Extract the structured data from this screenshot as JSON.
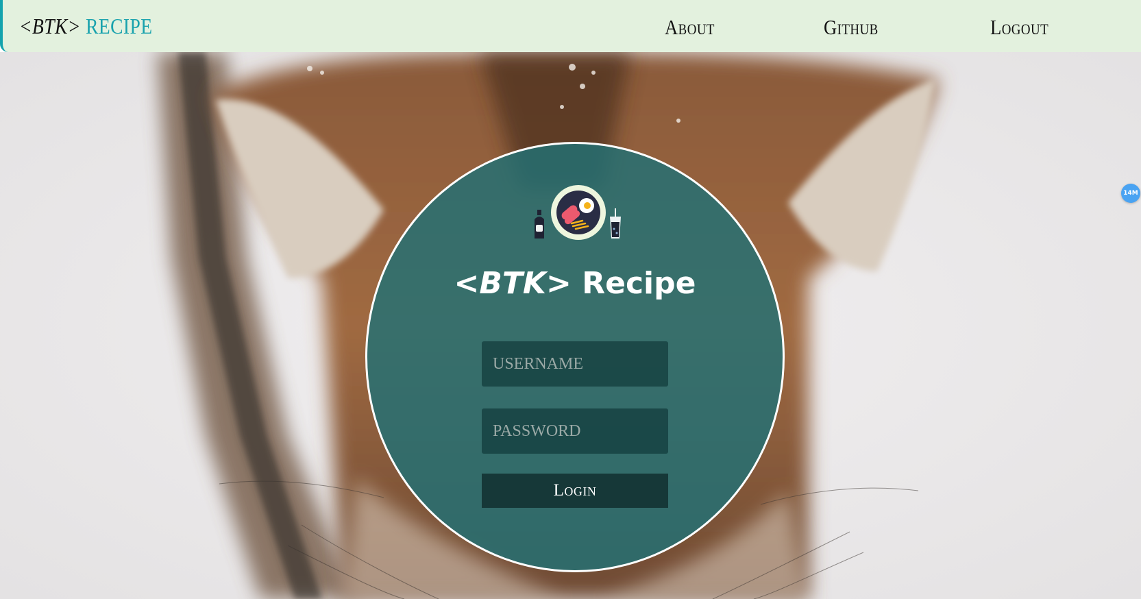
{
  "navbar": {
    "brand_tag": "<BTK>",
    "brand_word": "RECIPE",
    "links": [
      "About",
      "Github",
      "Logout"
    ]
  },
  "login": {
    "title_tag": "<BTK>",
    "title_word": "Recipe",
    "username_placeholder": "USERNAME",
    "password_placeholder": "PASSWORD",
    "button_label": "Login"
  },
  "side_badge": {
    "label": "14M"
  },
  "colors": {
    "navbar_bg": "#e3f1de",
    "brand_accent": "#18a2ad",
    "circle_overlay": "#217075",
    "button_bg": "#163838",
    "badge_bg": "#4aa3f2"
  },
  "icons": {
    "logo": "food-plate-icon",
    "bottle": "sauce-bottle-icon",
    "drink": "drink-cup-icon"
  }
}
